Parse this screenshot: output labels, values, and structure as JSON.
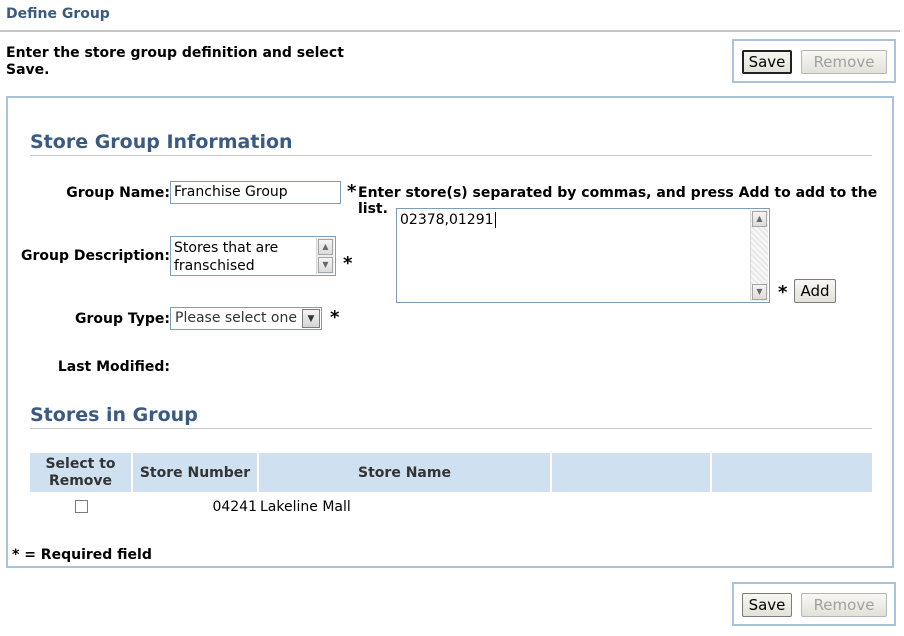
{
  "page_title": "Define Group",
  "instructions": "Enter the store group definition and select Save.",
  "buttons": {
    "save": "Save",
    "remove": "Remove"
  },
  "store_group_info": {
    "title": "Store Group Information",
    "group_name_label": "Group Name:",
    "group_name_value": "Franchise Group",
    "group_description_label": "Group Description:",
    "group_description_value": "Stores that are franschised",
    "group_type_label": "Group Type:",
    "group_type_selected": "Please select one",
    "last_modified_label": "Last Modified:",
    "required_marker": "*",
    "stores_prompt": "Enter store(s) separated by commas, and press Add to add to the list.",
    "stores_input_value": "02378,01291",
    "add_button": "Add"
  },
  "stores_in_group": {
    "title": "Stores in Group",
    "columns": [
      "Select to Remove",
      "Store Number",
      "Store Name",
      "",
      ""
    ],
    "rows": [
      {
        "selected": false,
        "store_number": "04241",
        "store_name": "Lakeline Mall"
      }
    ]
  },
  "required_note": "* = Required field"
}
